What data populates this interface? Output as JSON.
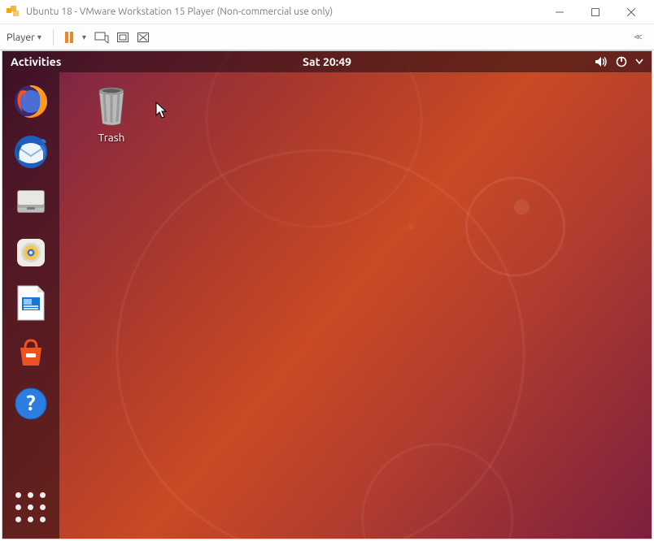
{
  "window": {
    "title": "Ubuntu 18 - VMware Workstation 15 Player (Non-commercial use only)"
  },
  "vmware_toolbar": {
    "player_label": "Player"
  },
  "panel": {
    "activities": "Activities",
    "clock": "Sat 20:49"
  },
  "dock": {
    "items": [
      {
        "id": "firefox",
        "name": "Firefox"
      },
      {
        "id": "thunderbird",
        "name": "Thunderbird"
      },
      {
        "id": "files",
        "name": "Files"
      },
      {
        "id": "rhythmbox",
        "name": "Rhythmbox"
      },
      {
        "id": "writer",
        "name": "LibreOffice Writer"
      },
      {
        "id": "software",
        "name": "Ubuntu Software"
      },
      {
        "id": "help",
        "name": "Help"
      }
    ],
    "show_apps": "Show Applications"
  },
  "desktop": {
    "trash_label": "Trash"
  }
}
